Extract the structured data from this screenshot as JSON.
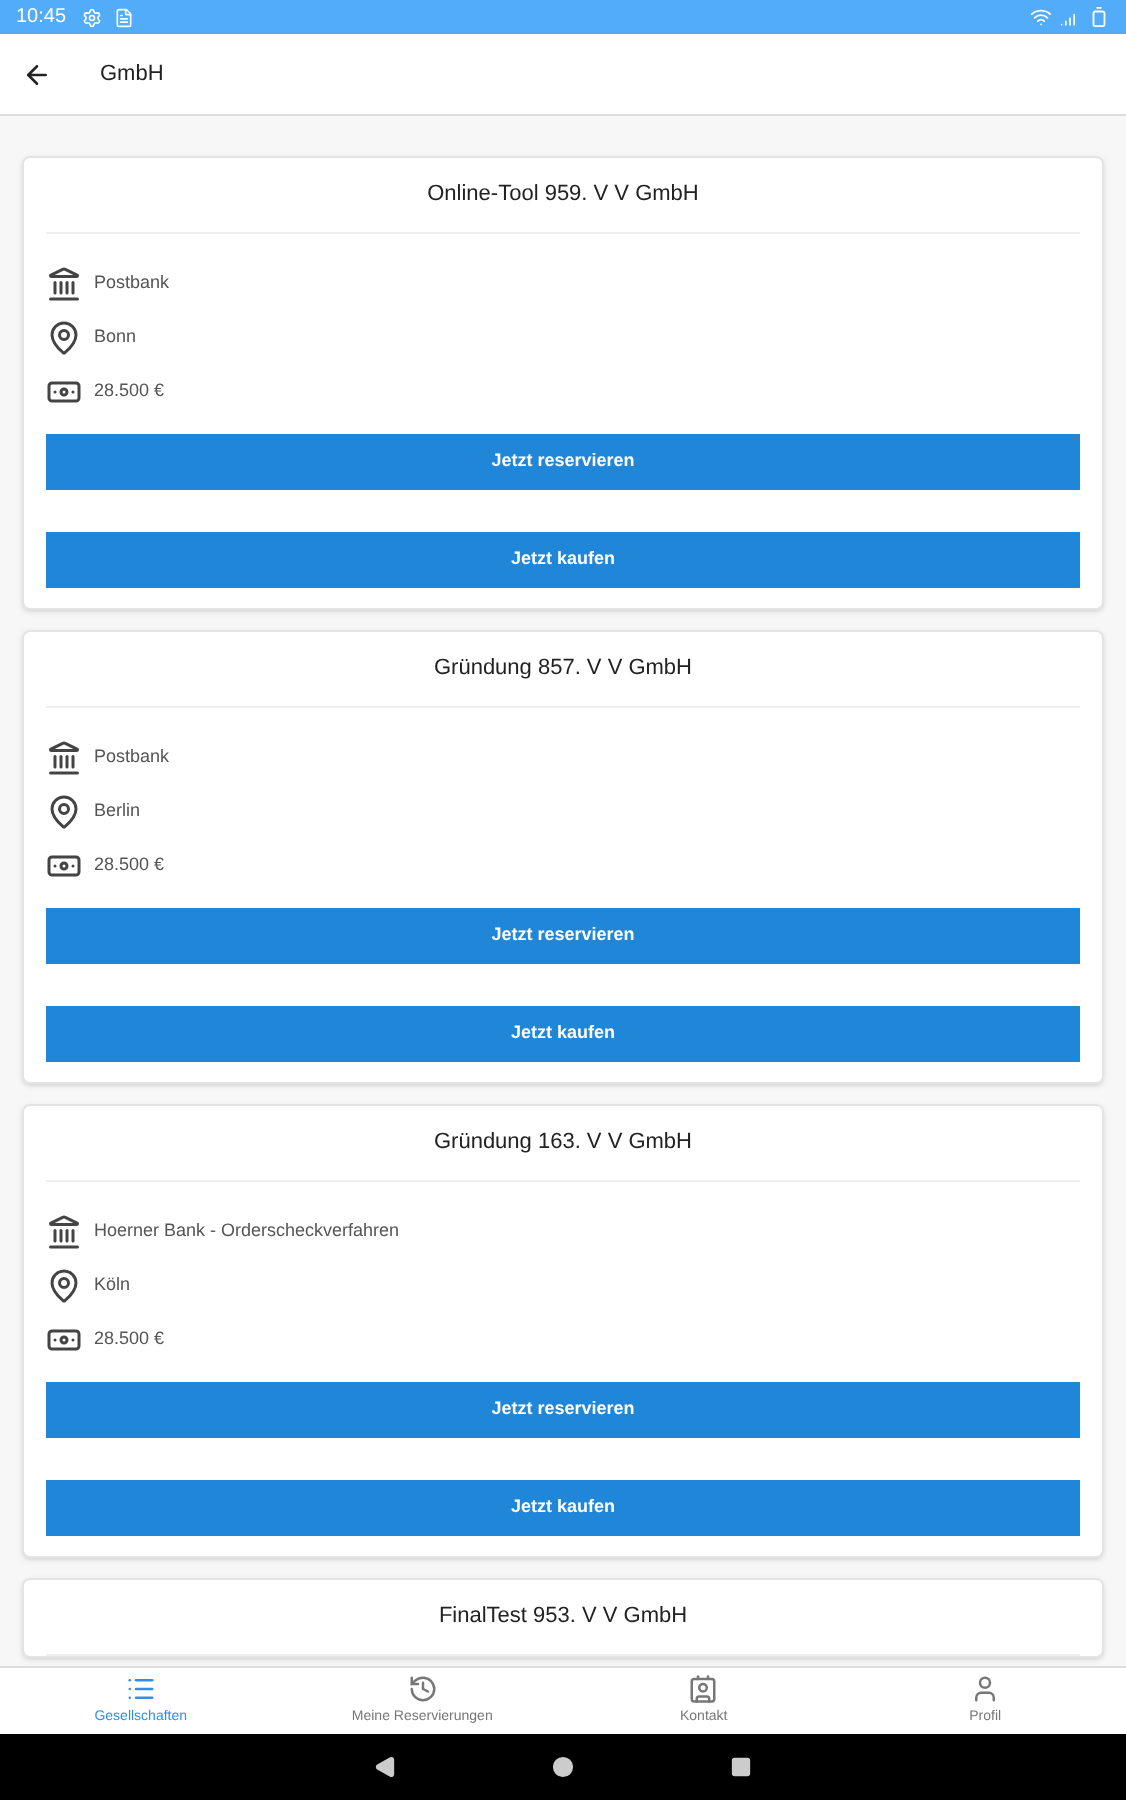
{
  "status_bar": {
    "time": "10:45"
  },
  "app_bar": {
    "title": "GmbH"
  },
  "companies": [
    {
      "name": "Online-Tool 959. V V GmbH",
      "bank": "Postbank",
      "city": "Bonn",
      "price": "28.500 €",
      "reserve_label": "Jetzt reservieren",
      "buy_label": "Jetzt kaufen"
    },
    {
      "name": "Gründung 857. V V GmbH",
      "bank": "Postbank",
      "city": "Berlin",
      "price": "28.500 €",
      "reserve_label": "Jetzt reservieren",
      "buy_label": "Jetzt kaufen"
    },
    {
      "name": "Gründung 163. V V GmbH",
      "bank": "Hoerner Bank - Orderscheckverfahren",
      "city": "Köln",
      "price": "28.500 €",
      "reserve_label": "Jetzt reservieren",
      "buy_label": "Jetzt kaufen"
    },
    {
      "name": "FinalTest 953. V V GmbH"
    }
  ],
  "bottom_nav": [
    {
      "label": "Gesellschaften",
      "selected": true
    },
    {
      "label": "Meine Reservierungen",
      "selected": false
    },
    {
      "label": "Kontakt",
      "selected": false
    },
    {
      "label": "Profil",
      "selected": false
    }
  ]
}
